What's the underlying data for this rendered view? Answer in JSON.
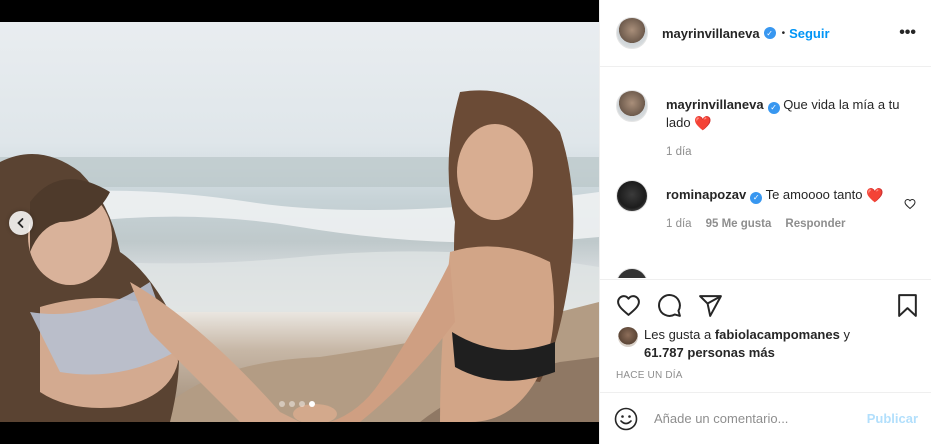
{
  "post": {
    "author": "mayrinvillaneva",
    "follow_label": "Seguir",
    "more_label": "•••",
    "bullet": "•"
  },
  "comments": [
    {
      "user": "mayrinvillaneva",
      "text": "Que vida la mía a tu lado",
      "emoji": "❤️",
      "time": "1 día"
    },
    {
      "user": "rominapozav",
      "text": "Te amoooo tanto",
      "emoji": "❤️",
      "time": "1 día",
      "likes": "95 Me gusta",
      "reply": "Responder"
    }
  ],
  "likes": {
    "prefix": "Les gusta a",
    "user": "fabiolacampomanes",
    "connector": "y",
    "count": "61.787 personas más"
  },
  "timestamp": "Hace un día",
  "comment_input": {
    "placeholder": "Añade un comentario...",
    "submit": "Publicar"
  },
  "carousel": {
    "total": 4,
    "active": 4
  },
  "colors": {
    "link": "#0095f6",
    "verified": "#3897f0",
    "publish_disabled": "#b2dffc",
    "heart": "#ed4956"
  },
  "icons": [
    "more-options-icon",
    "verified-icon",
    "heart-icon",
    "comment-icon",
    "share-icon",
    "bookmark-icon",
    "emoji-icon",
    "chevron-left-icon"
  ]
}
